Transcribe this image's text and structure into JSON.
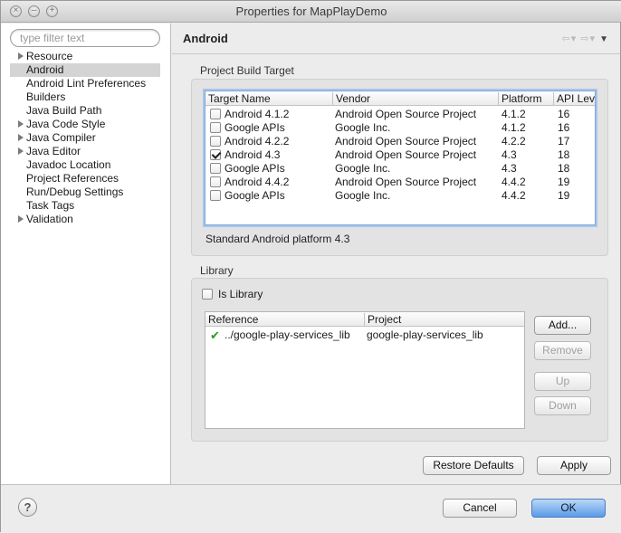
{
  "window": {
    "title": "Properties for MapPlayDemo"
  },
  "sidebar": {
    "filter_placeholder": "type filter text",
    "items": [
      {
        "label": "Resource",
        "expandable": true
      },
      {
        "label": "Android",
        "expandable": false,
        "selected": true
      },
      {
        "label": "Android Lint Preferences",
        "expandable": false
      },
      {
        "label": "Builders",
        "expandable": false
      },
      {
        "label": "Java Build Path",
        "expandable": false
      },
      {
        "label": "Java Code Style",
        "expandable": true
      },
      {
        "label": "Java Compiler",
        "expandable": true
      },
      {
        "label": "Java Editor",
        "expandable": true
      },
      {
        "label": "Javadoc Location",
        "expandable": false
      },
      {
        "label": "Project References",
        "expandable": false
      },
      {
        "label": "Run/Debug Settings",
        "expandable": false
      },
      {
        "label": "Task Tags",
        "expandable": false
      },
      {
        "label": "Validation",
        "expandable": true
      }
    ]
  },
  "page": {
    "title": "Android",
    "nav_icons": [
      "back-icon",
      "forward-icon",
      "view-menu-icon"
    ]
  },
  "build_target": {
    "group_label": "Project Build Target",
    "columns": [
      "Target Name",
      "Vendor",
      "Platform",
      "API Lev"
    ],
    "rows": [
      {
        "checked": false,
        "name": "Android 4.1.2",
        "vendor": "Android Open Source Project",
        "platform": "4.1.2",
        "api": "16"
      },
      {
        "checked": false,
        "name": "Google APIs",
        "vendor": "Google Inc.",
        "platform": "4.1.2",
        "api": "16"
      },
      {
        "checked": false,
        "name": "Android 4.2.2",
        "vendor": "Android Open Source Project",
        "platform": "4.2.2",
        "api": "17"
      },
      {
        "checked": true,
        "name": "Android 4.3",
        "vendor": "Android Open Source Project",
        "platform": "4.3",
        "api": "18"
      },
      {
        "checked": false,
        "name": "Google APIs",
        "vendor": "Google Inc.",
        "platform": "4.3",
        "api": "18"
      },
      {
        "checked": false,
        "name": "Android 4.4.2",
        "vendor": "Android Open Source Project",
        "platform": "4.4.2",
        "api": "19"
      },
      {
        "checked": false,
        "name": "Google APIs",
        "vendor": "Google Inc.",
        "platform": "4.4.2",
        "api": "19"
      }
    ],
    "description": "Standard Android platform 4.3"
  },
  "library": {
    "group_label": "Library",
    "is_library_label": "Is Library",
    "is_library_checked": false,
    "columns": [
      "Reference",
      "Project"
    ],
    "rows": [
      {
        "status_icon": "check-icon",
        "reference": "../google-play-services_lib",
        "project": "google-play-services_lib"
      }
    ],
    "buttons": {
      "add": "Add...",
      "remove": "Remove",
      "up": "Up",
      "down": "Down"
    }
  },
  "actions": {
    "restore_defaults": "Restore Defaults",
    "apply": "Apply",
    "cancel": "Cancel",
    "ok": "OK",
    "help_glyph": "?"
  },
  "colors": {
    "default_button": "#5a9be8",
    "focus_ring": "#7fa6db",
    "success_check": "#2b9a1f"
  }
}
